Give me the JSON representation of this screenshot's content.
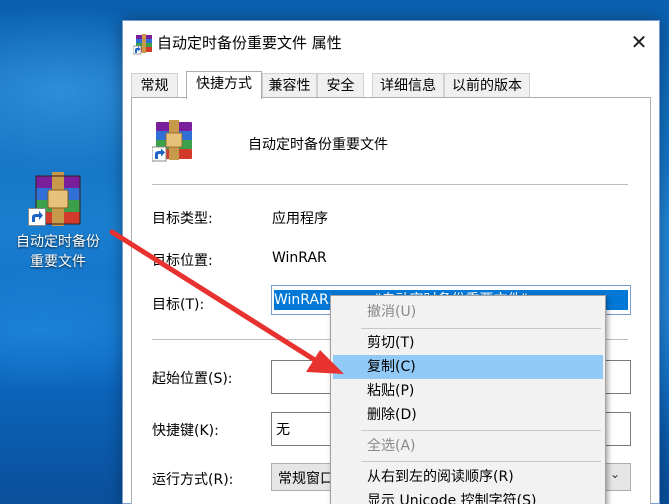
{
  "desktop": {
    "icon_label": "自动定时备份\n重要文件"
  },
  "dialog": {
    "title": "自动定时备份重要文件 属性",
    "close_glyph": "✕",
    "tabs": [
      {
        "label": "常规"
      },
      {
        "label": "快捷方式",
        "active": true
      },
      {
        "label": "兼容性"
      },
      {
        "label": "安全"
      },
      {
        "label": "详细信息"
      },
      {
        "label": "以前的版本"
      }
    ],
    "file_name": "自动定时备份重要文件",
    "fields": {
      "target_type_label": "目标类型:",
      "target_type_value": "应用程序",
      "target_location_label": "目标位置:",
      "target_location_value": "WinRAR",
      "target_label": "目标(T):",
      "target_value": "WinRAR.exe a \"自动定时备份重要文件\"",
      "start_in_label": "起始位置(S):",
      "start_in_value": "",
      "shortcut_key_label": "快捷键(K):",
      "shortcut_key_value": "无",
      "run_label": "运行方式(R):",
      "run_value": "常规窗口"
    }
  },
  "context_menu": {
    "items": [
      {
        "label": "撤消(U)",
        "state": "disabled"
      },
      {
        "label": "剪切(T)",
        "state": "normal"
      },
      {
        "label": "复制(C)",
        "state": "highlighted"
      },
      {
        "label": "粘贴(P)",
        "state": "normal"
      },
      {
        "label": "删除(D)",
        "state": "normal"
      },
      {
        "label": "全选(A)",
        "state": "disabled"
      },
      {
        "label": "从右到左的阅读顺序(R)",
        "state": "normal"
      },
      {
        "label": "显示 Unicode 控制字符(S)",
        "state": "normal"
      }
    ]
  },
  "icons": {
    "app": "winrar-archive-icon",
    "shortcut_overlay": "shortcut-arrow-icon",
    "annotation": "red-annotation-arrow"
  },
  "colors": {
    "selection": "#0078d7",
    "menu_highlight": "#91c9f7",
    "annotation_arrow": "#e8322f"
  }
}
